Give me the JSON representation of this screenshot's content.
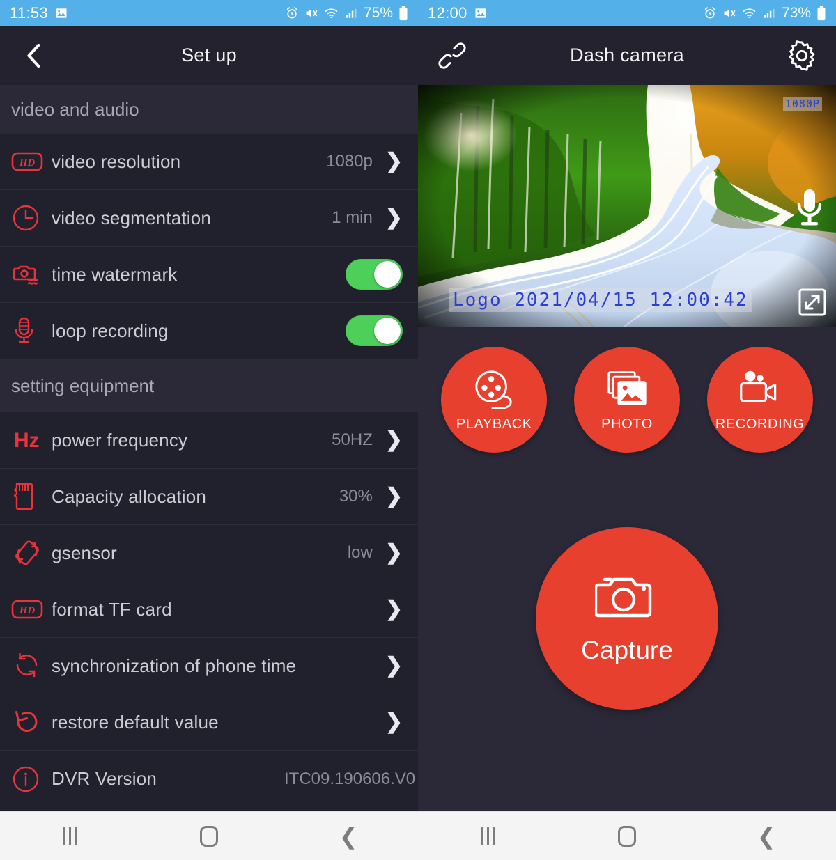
{
  "left": {
    "status": {
      "time": "11:53",
      "battery_pct": "75%",
      "icons": [
        "image-icon",
        "alarm-icon",
        "mute-icon",
        "wifi-icon",
        "signal-icon",
        "battery-icon"
      ]
    },
    "appbar": {
      "title": "Set up",
      "back_icon": "back-chevron-icon"
    },
    "sections": [
      {
        "title": "video and audio",
        "rows": [
          {
            "icon": "hd-icon",
            "label": "video resolution",
            "value": "1080p",
            "type": "nav"
          },
          {
            "icon": "clock-icon",
            "label": "video segmentation",
            "value": "1 min",
            "type": "nav"
          },
          {
            "icon": "camera-wave-icon",
            "label": "time watermark",
            "value": "",
            "type": "toggle",
            "on": true
          },
          {
            "icon": "microphone-icon",
            "label": "loop recording",
            "value": "",
            "type": "toggle",
            "on": true
          }
        ]
      },
      {
        "title": "setting equipment",
        "rows": [
          {
            "icon": "hz-icon",
            "label": "power frequency",
            "value": "50HZ",
            "type": "nav"
          },
          {
            "icon": "sdcard-icon",
            "label": "Capacity allocation",
            "value": "30%",
            "type": "nav"
          },
          {
            "icon": "gsensor-icon",
            "label": "gsensor",
            "value": "low",
            "type": "nav"
          },
          {
            "icon": "hd-icon",
            "label": "format TF card",
            "value": "",
            "type": "nav"
          },
          {
            "icon": "sync-icon",
            "label": "synchronization of phone time",
            "value": "",
            "type": "nav"
          },
          {
            "icon": "restore-icon",
            "label": "restore default value",
            "value": "",
            "type": "nav"
          },
          {
            "icon": "info-icon",
            "label": "DVR Version",
            "value": "ITC09.190606.V0",
            "type": "text"
          }
        ]
      }
    ]
  },
  "right": {
    "status": {
      "time": "12:00",
      "battery_pct": "73%",
      "icons": [
        "image-icon",
        "alarm-icon",
        "mute-icon",
        "wifi-icon",
        "signal-icon",
        "battery-icon"
      ]
    },
    "appbar": {
      "title": "Dash camera",
      "link_icon": "link-icon",
      "settings_icon": "gear-icon"
    },
    "video": {
      "resolution_badge": "1080P",
      "watermark": "Logo 2021/04/15 12:00:42",
      "mic_icon": "microphone-icon",
      "fullscreen_icon": "expand-icon",
      "scene": "forest road dash-cam view"
    },
    "actions": [
      {
        "icon": "film-reel-icon",
        "label": "PLAYBACK"
      },
      {
        "icon": "photos-icon",
        "label": "PHOTO"
      },
      {
        "icon": "video-camera-icon",
        "label": "RECORDING"
      }
    ],
    "capture": {
      "icon": "camera-icon",
      "label": "Capture"
    }
  },
  "navbar": {
    "recents": "recents-icon",
    "home": "home-icon",
    "back": "back-icon"
  },
  "colors": {
    "accent_red": "#e8402f",
    "toggle_green": "#4cd05a",
    "statusbar_blue": "#54b0e8",
    "panel_dark": "#21202d",
    "panel_header": "#2b2938",
    "watermark_blue": "#2b3fd0"
  }
}
